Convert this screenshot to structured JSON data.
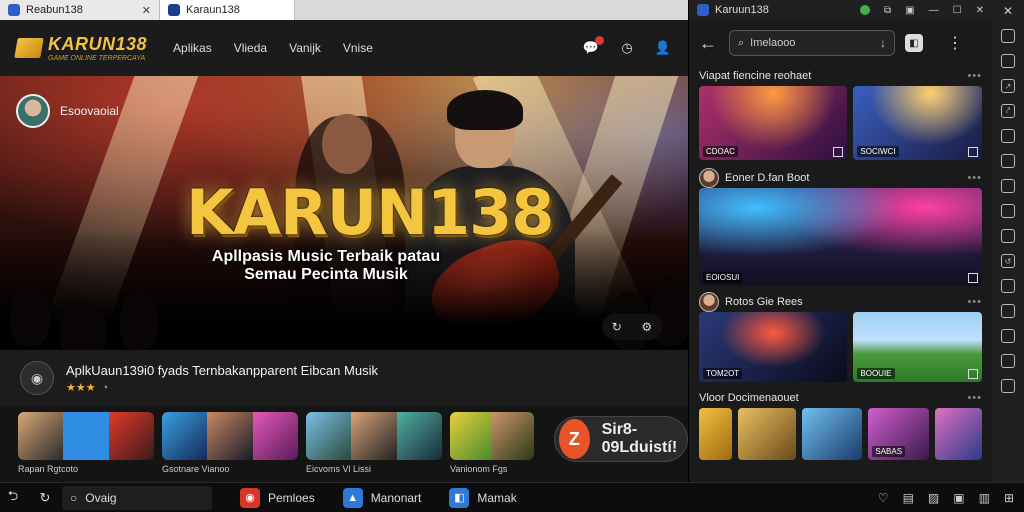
{
  "browser": {
    "tabs": [
      {
        "label": "Reabun138"
      },
      {
        "label": "Karaun138"
      }
    ]
  },
  "header": {
    "logo": "KARUN138",
    "logo_sub": "GAME ONLINE TERPERCAYA",
    "nav": [
      "Aplikas",
      "Vlieda",
      "Vanijk",
      "Vnise"
    ]
  },
  "hero": {
    "user": "Esoovaoial",
    "title": "KARUN138",
    "subtitle_line1": "Apllpasis Music Terbaik patau",
    "subtitle_line2": "Semau Pecinta Musik"
  },
  "info": {
    "title": "AplkUaun139i0 fyads Ternbakanpparent Eibcan Musik",
    "rating": "★★★",
    "comment_icon": "comment-icon"
  },
  "thumbnails": [
    {
      "caption": "Rapan Rgtcoto"
    },
    {
      "caption": "Gsotnare Vianoo"
    },
    {
      "caption": "Eicvoms Vl Lissi"
    },
    {
      "caption": "Vanionom Fgs"
    }
  ],
  "cta": {
    "label": "Sir8-09Lduistí!",
    "icon_text": "Z"
  },
  "right_window": {
    "title": "Karuun138",
    "search_value": "Imelaooo",
    "sections": [
      {
        "title": "Viapat fiencine reohaet"
      },
      {
        "title": "Eoner D.fan Boot"
      },
      {
        "title": "Rotos Gie Rees"
      },
      {
        "title": "Vloor Docimenaouet"
      }
    ],
    "card_tags": [
      "CDOAC",
      "SOCIWCI",
      "EOIOSUI",
      "TOM2OT",
      "BOOUIE",
      "SABAS"
    ]
  },
  "taskbar": {
    "search": "Ovaig",
    "apps": [
      {
        "label": "Pemloes",
        "color": "#d8362b"
      },
      {
        "label": "Manonart",
        "color": "#2f78d6"
      },
      {
        "label": "Mamak",
        "color": "#2f78d6"
      }
    ]
  },
  "colors": {
    "accent_gold": "#f4c53f",
    "cta_orange": "#e8532a",
    "background": "#161616"
  }
}
